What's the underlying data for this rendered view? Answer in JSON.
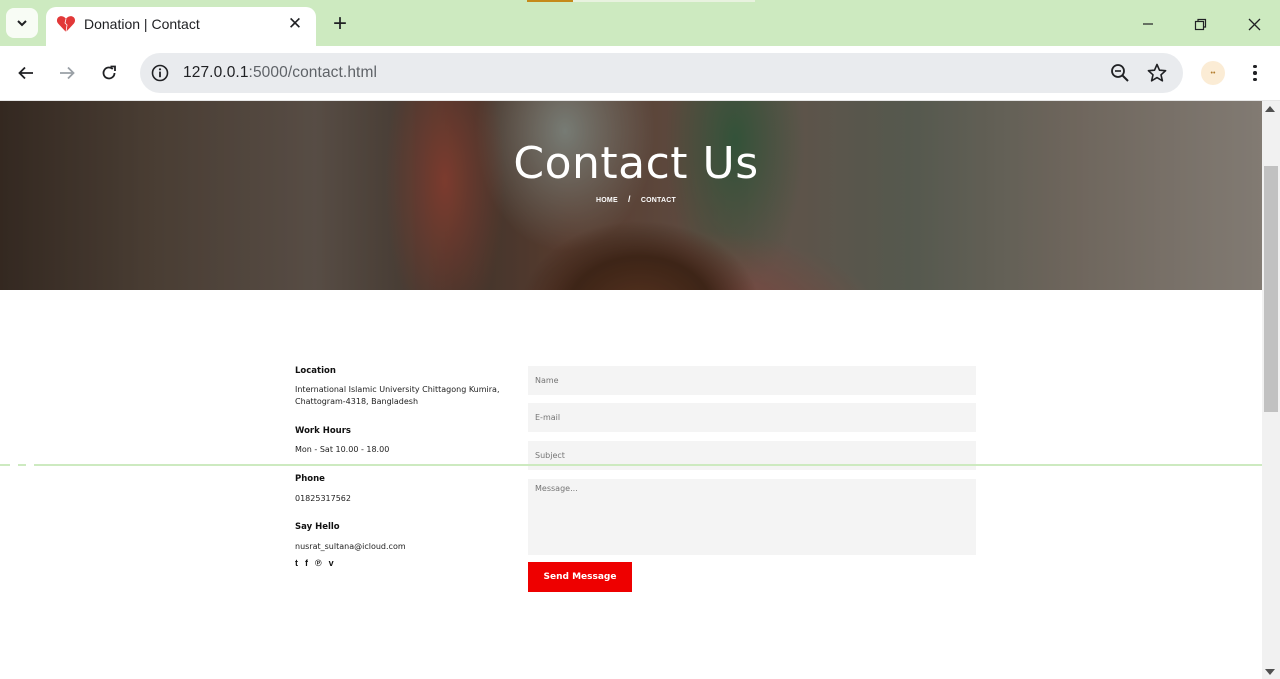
{
  "browser": {
    "tab": {
      "title": "Donation | Contact",
      "close_icon": "✕",
      "favicon": "heart-icon"
    },
    "new_tab_label": "+",
    "window": {
      "minimize": "minimize-icon",
      "restore": "restore-icon",
      "close": "close-icon"
    },
    "address": {
      "host": "127.0.0.1",
      "rest": ":5000/contact.html"
    },
    "profile_initial": "••"
  },
  "hero": {
    "title": "Contact Us",
    "breadcrumb_home": "HOME",
    "breadcrumb_sep": "/",
    "breadcrumb_current": "CONTACT"
  },
  "contact_info": {
    "location_heading": "Location",
    "location_text": "International Islamic University Chittagong Kumira, Chattogram-4318, Bangladesh",
    "hours_heading": "Work Hours",
    "hours_text": "Mon - Sat 10.00 - 18.00",
    "phone_heading": "Phone",
    "phone_text": "01825317562",
    "hello_heading": "Say Hello",
    "email_text": "nusrat_sultana@icloud.com",
    "socials": [
      {
        "label": "t",
        "icon": "tumblr-icon"
      },
      {
        "label": "f",
        "icon": "facebook-icon"
      },
      {
        "label": "℗",
        "icon": "pinterest-icon"
      },
      {
        "label": "v",
        "icon": "vimeo-icon"
      }
    ]
  },
  "form": {
    "name_placeholder": "Name",
    "email_placeholder": "E-mail",
    "subject_placeholder": "Subject",
    "message_placeholder": "Message...",
    "submit_label": "Send Message"
  },
  "colors": {
    "accent": "#ee0000",
    "tabstrip": "#cdeac0",
    "field_bg": "#f4f4f4"
  }
}
